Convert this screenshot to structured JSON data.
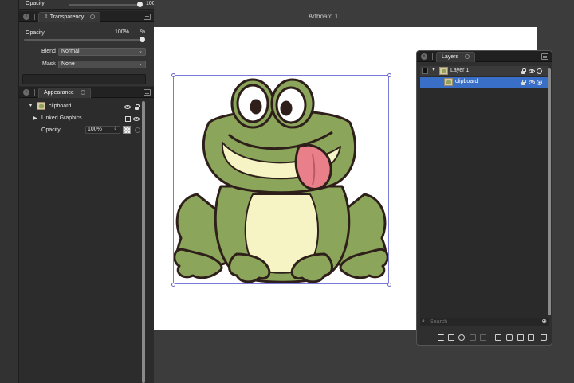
{
  "top_strip": {
    "label": "Opacity",
    "value": "100%",
    "slider": 1.0
  },
  "transparency": {
    "tab": "Transparency",
    "opacity_label": "Opacity",
    "opacity_value": "100%",
    "opacity_unit": "%",
    "opacity_slider": 1.0,
    "blend_label": "Blend",
    "blend_value": "Normal",
    "mask_label": "Mask",
    "mask_value": "None"
  },
  "appearance": {
    "tab": "Appearance",
    "object_name": "clipboard",
    "linked_label": "Linked Graphics",
    "opacity_label": "Opacity",
    "opacity_value": "100%"
  },
  "canvas": {
    "artboard_title": "Artboard 1"
  },
  "layers": {
    "tab": "Layers",
    "rows": [
      {
        "name": "Layer 1",
        "selected": false
      },
      {
        "name": "clipboard",
        "selected": true
      }
    ],
    "search_placeholder": "Search"
  },
  "colors": {
    "panel_bg": "#2a2a2a",
    "selection": "#3a6fc7",
    "artboard": "#ffffff",
    "frog_green": "#8ba55b",
    "frog_cream": "#f6f4c4",
    "tongue": "#e98089"
  },
  "icons": {
    "close": "close-icon",
    "panel_menu": "panel-menu-icon",
    "disclosure": "disclosure-triangle-icon",
    "eye": "eye-icon",
    "lock": "lock-icon",
    "target": "target-circle-icon",
    "search": "search-icon",
    "zoom": "zoom-icon"
  }
}
